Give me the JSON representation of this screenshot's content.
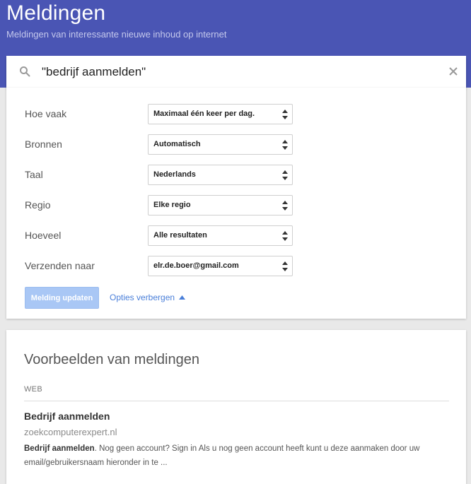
{
  "header": {
    "title": "Meldingen",
    "subtitle": "Meldingen van interessante nieuwe inhoud op internet"
  },
  "search": {
    "query": "\"bedrijf aanmelden\"",
    "icon": "search-icon",
    "clear_icon": "close-icon"
  },
  "options": [
    {
      "label": "Hoe vaak",
      "value": "Maximaal één keer per dag."
    },
    {
      "label": "Bronnen",
      "value": "Automatisch"
    },
    {
      "label": "Taal",
      "value": "Nederlands"
    },
    {
      "label": "Regio",
      "value": "Elke regio"
    },
    {
      "label": "Hoeveel",
      "value": "Alle resultaten"
    },
    {
      "label": "Verzenden naar",
      "value": "elr.de.boer@gmail.com"
    }
  ],
  "actions": {
    "update_label": "Melding updaten",
    "toggle_label": "Opties verbergen"
  },
  "examples": {
    "heading": "Voorbeelden van meldingen",
    "section_label": "WEB",
    "result": {
      "title": "Bedrijf aanmelden",
      "url": "zoekcomputerexpert.nl",
      "snippet_bold": "Bedrijf aanmelden",
      "snippet_rest": ". Nog geen account? Sign in Als u nog geen account heeft kunt u deze aanmaken door uw email/gebruikersnaam hieronder in te ..."
    }
  },
  "colors": {
    "header_bg": "#4a55b4",
    "button_disabled_bg": "#a9c7f5",
    "link": "#4a7fd9"
  }
}
